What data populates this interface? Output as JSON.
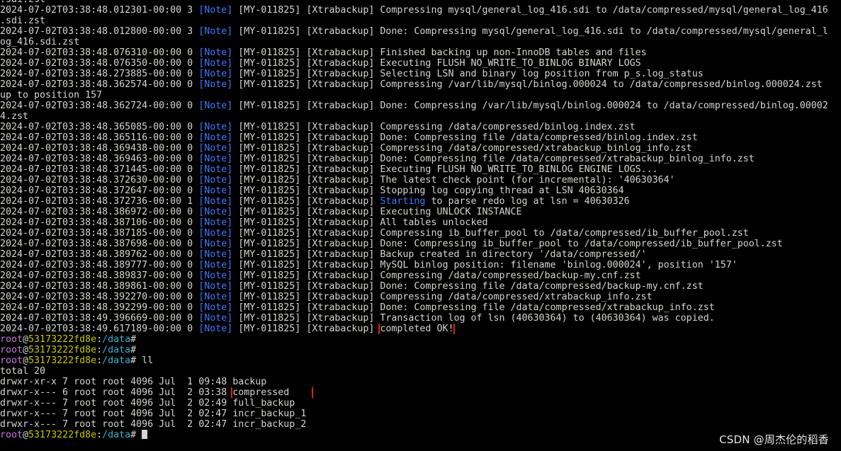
{
  "terminal": {
    "prompt": {
      "user": "root",
      "at": "@",
      "host": "53173222fd8e",
      "colon": ":",
      "path": "/data",
      "hash": "#"
    },
    "log_tag": "[Note]",
    "log_lines": [
      {
        "pre": ".sdi.zst",
        "tag": "",
        "post": ""
      },
      {
        "pre": "2024-07-02T03:38:48.012301-00:00 3 ",
        "tag": "[Note]",
        "post": " [MY-011825] [Xtrabackup] Compressing mysql/general_log_416.sdi to /data/compressed/mysql/general_log_416"
      },
      {
        "pre": ".sdi.zst",
        "tag": "",
        "post": ""
      },
      {
        "pre": "2024-07-02T03:38:48.012800-00:00 3 ",
        "tag": "[Note]",
        "post": " [MY-011825] [Xtrabackup] Done: Compressing mysql/general_log_416.sdi to /data/compressed/mysql/general_l"
      },
      {
        "pre": "og_416.sdi.zst",
        "tag": "",
        "post": ""
      },
      {
        "pre": "2024-07-02T03:38:48.076310-00:00 0 ",
        "tag": "[Note]",
        "post": " [MY-011825] [Xtrabackup] Finished backing up non-InnoDB tables and files"
      },
      {
        "pre": "2024-07-02T03:38:48.076350-00:00 0 ",
        "tag": "[Note]",
        "post": " [MY-011825] [Xtrabackup] Executing FLUSH NO_WRITE_TO_BINLOG BINARY LOGS"
      },
      {
        "pre": "2024-07-02T03:38:48.273885-00:00 0 ",
        "tag": "[Note]",
        "post": " [MY-011825] [Xtrabackup] Selecting LSN and binary log position from p_s.log_status"
      },
      {
        "pre": "2024-07-02T03:38:48.362574-00:00 0 ",
        "tag": "[Note]",
        "post": " [MY-011825] [Xtrabackup] Compressing /var/lib/mysql/binlog.000024 to /data/compressed/binlog.000024.zst"
      },
      {
        "pre": "up to position 157",
        "tag": "",
        "post": ""
      },
      {
        "pre": "2024-07-02T03:38:48.362724-00:00 0 ",
        "tag": "[Note]",
        "post": " [MY-011825] [Xtrabackup] Done: Compressing /var/lib/mysql/binlog.000024 to /data/compressed/binlog.00002"
      },
      {
        "pre": "4.zst",
        "tag": "",
        "post": ""
      },
      {
        "pre": "2024-07-02T03:38:48.365085-00:00 0 ",
        "tag": "[Note]",
        "post": " [MY-011825] [Xtrabackup] Compressing /data/compressed/binlog.index.zst"
      },
      {
        "pre": "2024-07-02T03:38:48.365116-00:00 0 ",
        "tag": "[Note]",
        "post": " [MY-011825] [Xtrabackup] Done: Compressing file /data/compressed/binlog.index.zst"
      },
      {
        "pre": "2024-07-02T03:38:48.369438-00:00 0 ",
        "tag": "[Note]",
        "post": " [MY-011825] [Xtrabackup] Compressing /data/compressed/xtrabackup_binlog_info.zst"
      },
      {
        "pre": "2024-07-02T03:38:48.369463-00:00 0 ",
        "tag": "[Note]",
        "post": " [MY-011825] [Xtrabackup] Done: Compressing file /data/compressed/xtrabackup_binlog_info.zst"
      },
      {
        "pre": "2024-07-02T03:38:48.371445-00:00 0 ",
        "tag": "[Note]",
        "post": " [MY-011825] [Xtrabackup] Executing FLUSH NO_WRITE_TO_BINLOG ENGINE LOGS..."
      },
      {
        "pre": "2024-07-02T03:38:48.372630-00:00 0 ",
        "tag": "[Note]",
        "post": " [MY-011825] [Xtrabackup] The latest check point (for incremental): '40630364'"
      },
      {
        "pre": "2024-07-02T03:38:48.372647-00:00 0 ",
        "tag": "[Note]",
        "post": " [MY-011825] [Xtrabackup] Stopping log copying thread at LSN 40630364"
      },
      {
        "pre": "2024-07-02T03:38:48.372736-00:00 1 ",
        "tag": "[Note]",
        "post": " [MY-011825] [Xtrabackup] ",
        "accent": "Starting",
        "tail": " to parse redo log at lsn = 40630326"
      },
      {
        "pre": "2024-07-02T03:38:48.386972-00:00 0 ",
        "tag": "[Note]",
        "post": " [MY-011825] [Xtrabackup] Executing UNLOCK INSTANCE"
      },
      {
        "pre": "2024-07-02T03:38:48.387106-00:00 0 ",
        "tag": "[Note]",
        "post": " [MY-011825] [Xtrabackup] All tables unlocked"
      },
      {
        "pre": "2024-07-02T03:38:48.387185-00:00 0 ",
        "tag": "[Note]",
        "post": " [MY-011825] [Xtrabackup] Compressing ib_buffer_pool to /data/compressed/ib_buffer_pool.zst"
      },
      {
        "pre": "2024-07-02T03:38:48.387698-00:00 0 ",
        "tag": "[Note]",
        "post": " [MY-011825] [Xtrabackup] Done: Compressing ib_buffer_pool to /data/compressed/ib_buffer_pool.zst"
      },
      {
        "pre": "2024-07-02T03:38:48.389762-00:00 0 ",
        "tag": "[Note]",
        "post": " [MY-011825] [Xtrabackup] Backup created in directory '/data/compressed/'"
      },
      {
        "pre": "2024-07-02T03:38:48.389777-00:00 0 ",
        "tag": "[Note]",
        "post": " [MY-011825] [Xtrabackup] MySQL binlog position: filename 'binlog.000024', position '157'"
      },
      {
        "pre": "2024-07-02T03:38:48.389837-00:00 0 ",
        "tag": "[Note]",
        "post": " [MY-011825] [Xtrabackup] Compressing /data/compressed/backup-my.cnf.zst"
      },
      {
        "pre": "2024-07-02T03:38:48.389861-00:00 0 ",
        "tag": "[Note]",
        "post": " [MY-011825] [Xtrabackup] Done: Compressing file /data/compressed/backup-my.cnf.zst"
      },
      {
        "pre": "2024-07-02T03:38:48.392270-00:00 0 ",
        "tag": "[Note]",
        "post": " [MY-011825] [Xtrabackup] Compressing /data/compressed/xtrabackup_info.zst"
      },
      {
        "pre": "2024-07-02T03:38:48.392299-00:00 0 ",
        "tag": "[Note]",
        "post": " [MY-011825] [Xtrabackup] Done: Compressing file /data/compressed/xtrabackup_info.zst"
      },
      {
        "pre": "2024-07-02T03:38:49.396669-00:00 0 ",
        "tag": "[Note]",
        "post": " [MY-011825] [Xtrabackup] Transaction log of lsn (40630364) to (40630364) was copied."
      },
      {
        "pre": "2024-07-02T03:38:49.617189-00:00 0 ",
        "tag": "[Note]",
        "post": " [MY-011825] [Xtrabackup] ",
        "boxed": "completed OK!"
      }
    ],
    "prompt_lines": [
      {
        "command": ""
      },
      {
        "command": ""
      },
      {
        "command": " ll"
      }
    ],
    "ls_total": "total 20",
    "ls_entries": [
      {
        "meta": "drwxr-xr-x 7 root root 4096 Jul  1 09:48 ",
        "name": "backup",
        "boxed": false
      },
      {
        "meta": "drwxr-x--- 6 root root 4096 Jul  2 03:38 ",
        "name": "compressed",
        "boxed": true
      },
      {
        "meta": "drwxr-x--- 7 root root 4096 Jul  2 02:49 ",
        "name": "full_backup",
        "boxed": false
      },
      {
        "meta": "drwxr-x--- 7 root root 4096 Jul  2 02:47 ",
        "name": "incr_backup_1",
        "boxed": false
      },
      {
        "meta": "drwxr-x--- 7 root root 4096 Jul  2 02:47 ",
        "name": "incr_backup_2",
        "boxed": false
      }
    ],
    "final_prompt_command": " "
  },
  "watermark": "CSDN @周杰伦的稻香",
  "colors": {
    "background": "#000000",
    "foreground": "#d3d7cf",
    "note_tag": "#3b78ff",
    "prompt_user": "#c678dd",
    "prompt_host": "#c8c800",
    "prompt_path": "#2fb5d0",
    "highlight_box": "#e01b1b"
  }
}
